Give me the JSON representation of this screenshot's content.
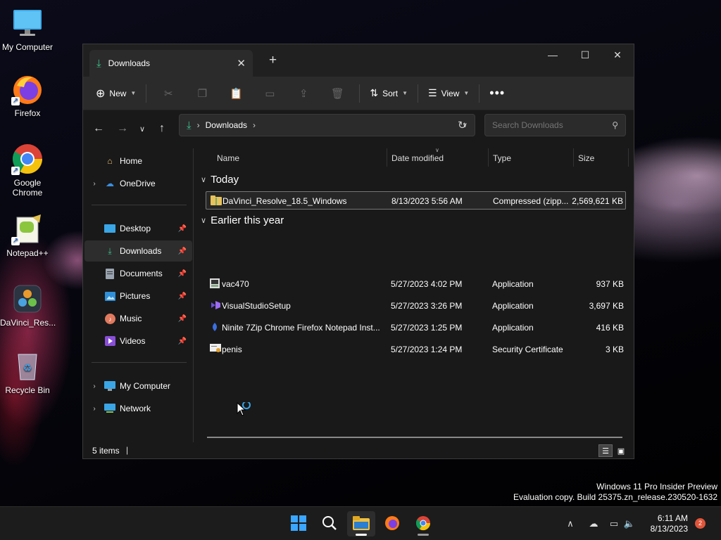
{
  "desktop": {
    "icons": [
      {
        "label": "My Computer"
      },
      {
        "label": "Firefox"
      },
      {
        "label": "Google Chrome"
      },
      {
        "label": "Notepad++"
      },
      {
        "label": "DaVinci_Res..."
      },
      {
        "label": "Recycle Bin"
      }
    ],
    "watermark": {
      "line1": "Windows 11 Pro Insider Preview",
      "line2": "Evaluation copy. Build 25375.zn_release.230520-1632"
    }
  },
  "window": {
    "tab_title": "Downloads",
    "toolbar": {
      "new_label": "New",
      "sort_label": "Sort",
      "view_label": "View"
    },
    "address": {
      "crumb": "Downloads"
    },
    "search": {
      "placeholder": "Search Downloads"
    },
    "sidebar": {
      "home": "Home",
      "onedrive": "OneDrive",
      "quick": [
        {
          "label": "Desktop"
        },
        {
          "label": "Downloads"
        },
        {
          "label": "Documents"
        },
        {
          "label": "Pictures"
        },
        {
          "label": "Music"
        },
        {
          "label": "Videos"
        }
      ],
      "mycomputer": "My Computer",
      "network": "Network"
    },
    "columns": {
      "name": "Name",
      "date": "Date modified",
      "type": "Type",
      "size": "Size"
    },
    "groups": {
      "today": "Today",
      "earlier": "Earlier this year"
    },
    "files": [
      {
        "name": "DaVinci_Resolve_18.5_Windows",
        "date": "8/13/2023 5:56 AM",
        "type": "Compressed (zipp...",
        "size": "2,569,621 KB"
      },
      {
        "name": "vac470",
        "date": "5/27/2023 4:02 PM",
        "type": "Application",
        "size": "937 KB"
      },
      {
        "name": "VisualStudioSetup",
        "date": "5/27/2023 3:26 PM",
        "type": "Application",
        "size": "3,697 KB"
      },
      {
        "name": "Ninite 7Zip Chrome Firefox Notepad Inst...",
        "date": "5/27/2023 1:25 PM",
        "type": "Application",
        "size": "416 KB"
      },
      {
        "name": "penis",
        "date": "5/27/2023 1:24 PM",
        "type": "Security Certificate",
        "size": "3 KB"
      }
    ],
    "status": {
      "count": "5 items"
    }
  },
  "taskbar": {
    "time": "6:11 AM",
    "date": "8/13/2023",
    "notifications": "2"
  }
}
